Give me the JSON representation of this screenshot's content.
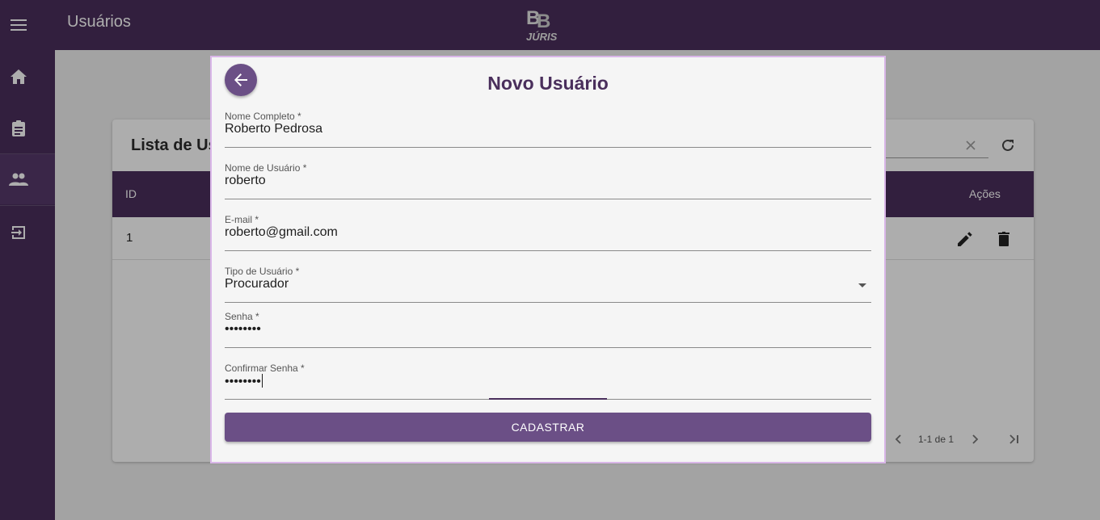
{
  "header": {
    "title": "Usuários",
    "menu_icon": "hamburger-menu-icon",
    "logo": {
      "top": "B B",
      "bottom": "JÚRIS"
    }
  },
  "sidebar": {
    "items": [
      {
        "icon": "home-icon",
        "active": false
      },
      {
        "icon": "clipboard-icon",
        "active": false
      },
      {
        "icon": "people-icon",
        "active": true
      },
      {
        "icon": "logout-icon",
        "active": false
      }
    ]
  },
  "background_card": {
    "title": "Lista de Us",
    "table": {
      "headers": {
        "id": "ID",
        "actions": "Ações"
      },
      "rows": [
        {
          "id": "1"
        }
      ]
    },
    "pagination": {
      "label": "1-1 de 1"
    }
  },
  "dialog": {
    "title": "Novo Usuário",
    "fields": {
      "full_name": {
        "label": "Nome Completo *",
        "value": "Roberto Pedrosa"
      },
      "username": {
        "label": "Nome de Usuário *",
        "value": "roberto"
      },
      "email": {
        "label": "E-mail *",
        "value": "roberto@gmail.com"
      },
      "user_type": {
        "label": "Tipo de Usuário *",
        "value": "Procurador"
      },
      "password": {
        "label": "Senha *",
        "value": "••••••••"
      },
      "confirm_password": {
        "label": "Confirmar Senha *",
        "value": "••••••••"
      }
    },
    "submit_label": "CADASTRAR"
  },
  "colors": {
    "primary": "#4a2f5c",
    "button": "#6b4f86",
    "dialog_border": "#d9b6e8"
  }
}
